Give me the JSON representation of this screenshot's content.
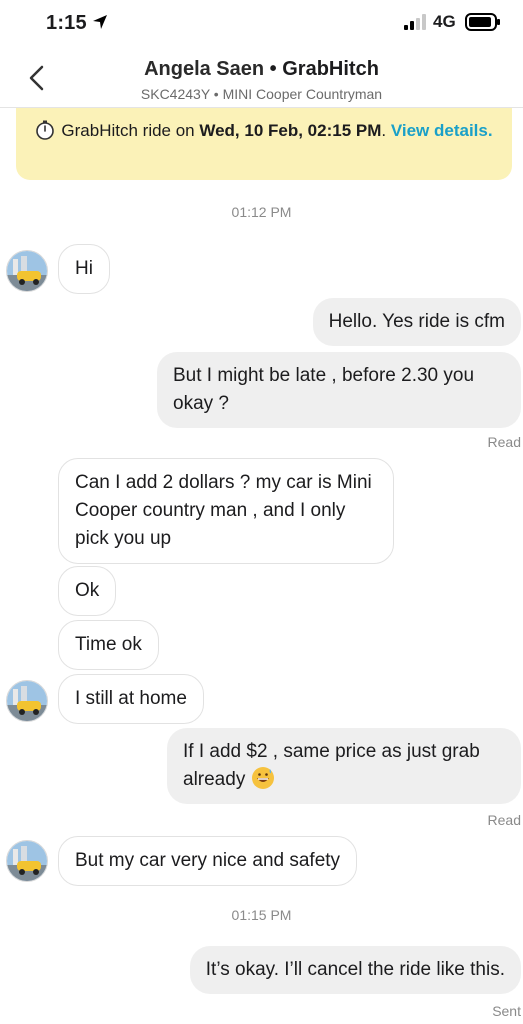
{
  "status_bar": {
    "time": "1:15",
    "network": "4G"
  },
  "header": {
    "name": "Angela Saen",
    "separator": " • ",
    "service": "GrabHitch",
    "plate": "SKC4243Y",
    "vehicle": " • MINI Cooper Countryman"
  },
  "banner": {
    "prefix": "GrabHitch ride on ",
    "datetime": "Wed, 10 Feb, 02:15 PM",
    "dot": ". ",
    "link": "View details."
  },
  "timestamps": [
    "01:12 PM",
    "01:15 PM"
  ],
  "messages": [
    {
      "text": "Hi"
    },
    {
      "text": "Hello. Yes ride is cfm"
    },
    {
      "text": "But I might be late , before 2.30 you okay ?"
    },
    {
      "text": "Can I add 2 dollars ?  my car is Mini Cooper country man ,  and I only pick you up"
    },
    {
      "text": "Ok"
    },
    {
      "text": "Time ok"
    },
    {
      "text": "I still at home"
    },
    {
      "text": "If I add $2 , same price as just grab already"
    },
    {
      "text": "But my car very nice and safety"
    },
    {
      "text": "It’s okay. I’ll cancel the ride like this."
    }
  ],
  "receipts": [
    "Read",
    "Read",
    "Sent"
  ],
  "icons": {
    "back": "chevron-left-icon",
    "location": "location-arrow-icon",
    "clock": "stopwatch-icon",
    "emoji": "grinning-sweat-emoji"
  }
}
